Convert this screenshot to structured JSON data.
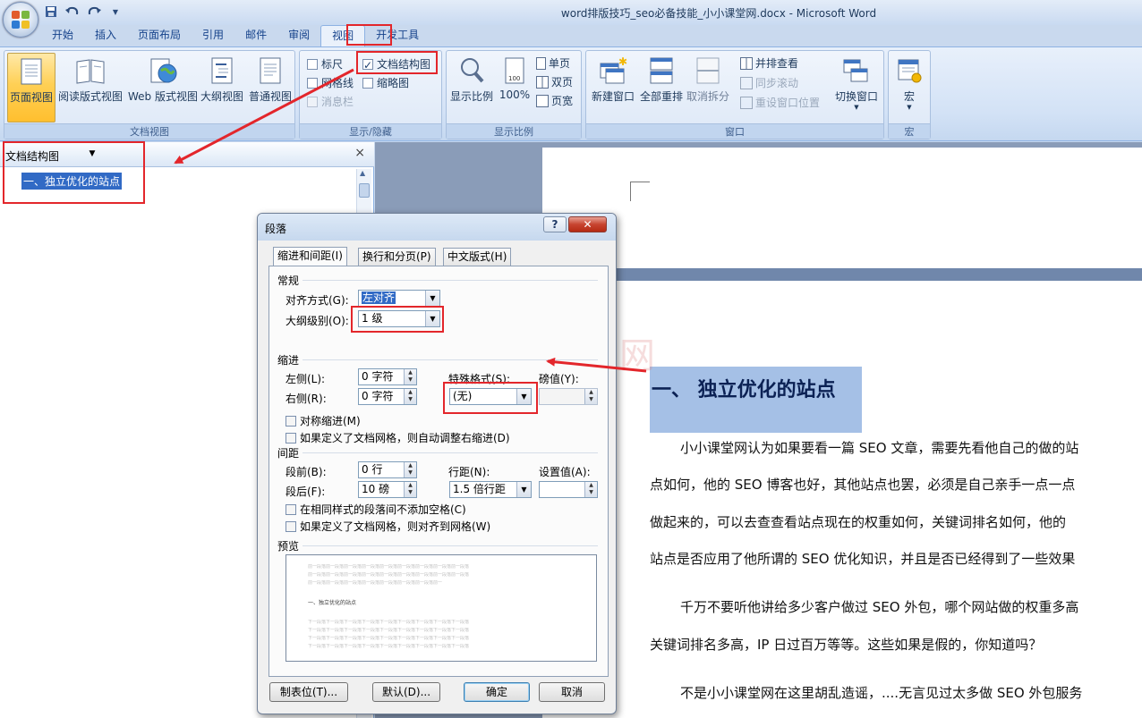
{
  "window": {
    "title": "word排版技巧_seo必备技能_小小课堂网.docx - Microsoft Word"
  },
  "quick_access": {
    "save_icon": "save-icon",
    "undo_icon": "undo-icon",
    "redo_icon": "redo-icon",
    "customize_icon": "customize-qat-icon"
  },
  "tabs": [
    {
      "label": "开始"
    },
    {
      "label": "插入"
    },
    {
      "label": "页面布局"
    },
    {
      "label": "引用"
    },
    {
      "label": "邮件"
    },
    {
      "label": "审阅"
    },
    {
      "label": "视图",
      "active": true
    },
    {
      "label": "开发工具"
    }
  ],
  "ribbon": {
    "doc_views": {
      "label": "文档视图",
      "buttons": [
        "页面视图",
        "阅读版式视图",
        "Web 版式视图",
        "大纲视图",
        "普通视图"
      ]
    },
    "show_hide": {
      "label": "显示/隐藏",
      "ruler": "标尺",
      "gridlines": "网格线",
      "message_bar": "消息栏",
      "doc_map": "文档结构图",
      "thumbnails": "缩略图"
    },
    "zoom": {
      "label": "显示比例",
      "zoom": "显示比例",
      "hundred": "100%",
      "one_page": "单页",
      "two_pages": "双页",
      "page_width": "页宽"
    },
    "window": {
      "label": "窗口",
      "new_window": "新建窗口",
      "arrange_all": "全部重排",
      "split": "取消拆分",
      "side_by_side": "并排查看",
      "sync_scroll": "同步滚动",
      "reset_pos": "重设窗口位置",
      "switch": "切换窗口"
    },
    "macros": {
      "label": "宏",
      "macro": "宏"
    }
  },
  "doc_map": {
    "title": "文档结构图",
    "close": "×",
    "item": "一、独立优化的站点"
  },
  "dialog": {
    "title": "段落",
    "help": "?",
    "close": "✕",
    "tabs": [
      "缩进和间距(I)",
      "换行和分页(P)",
      "中文版式(H)"
    ],
    "general": {
      "section": "常规",
      "alignment_label": "对齐方式(G):",
      "alignment_value": "左对齐",
      "outline_label": "大纲级别(O):",
      "outline_value": "1 级"
    },
    "indent": {
      "section": "缩进",
      "left_label": "左侧(L):",
      "left_value": "0 字符",
      "right_label": "右侧(R):",
      "right_value": "0 字符",
      "special_label": "特殊格式(S):",
      "special_value": "(无)",
      "by_label": "磅值(Y):",
      "mirror": "对称缩进(M)",
      "auto_adjust": "如果定义了文档网格，则自动调整右缩进(D)"
    },
    "spacing": {
      "section": "间距",
      "before_label": "段前(B):",
      "before_value": "0 行",
      "after_label": "段后(F):",
      "after_value": "10 磅",
      "line_label": "行距(N):",
      "line_value": "1.5 倍行距",
      "at_label": "设置值(A):",
      "no_space": "在相同样式的段落间不添加空格(C)",
      "snap_grid": "如果定义了文档网格，则对齐到网格(W)"
    },
    "preview": {
      "section": "预览",
      "prev_text": "前一段落前一段落前一段落前一段落前一段落前一段落前一段落前一段落前一段落",
      "heading": "一、独立优化的站点",
      "next_text": "下一段落下一段落下一段落下一段落下一段落下一段落下一段落下一段落下一段落"
    },
    "buttons": {
      "tabs": "制表位(T)...",
      "default": "默认(D)...",
      "ok": "确定",
      "cancel": "取消"
    }
  },
  "document": {
    "heading": "一、 独立优化的站点",
    "paragraphs": [
      "小小课堂网认为如果要看一篇 SEO 文章，需要先看他自己的做的站",
      "点如何，他的 SEO 博客也好，其他站点也罢，必须是自己亲手一点一点",
      "做起来的，可以去查查看站点现在的权重如何，关键词排名如何，他的",
      "站点是否应用了他所谓的  SEO  优化知识，并且是否已经得到了一些效果",
      "千万不要听他讲给多少客户做过  SEO  外包，哪个网站做的权重多高",
      "关键词排名多高，IP 日过百万等等。这些如果是假的，你知道吗？",
      "不是小小课堂网在这里胡乱造谣，....无言见过太多做 SEO 外包服务"
    ],
    "watermark": "小小课堂网"
  },
  "colors": {
    "annotation_red": "#e3262b",
    "heading_highlight": "#a5c0e6",
    "ribbon_active": "#ffd055",
    "selection": "#316ac5"
  }
}
